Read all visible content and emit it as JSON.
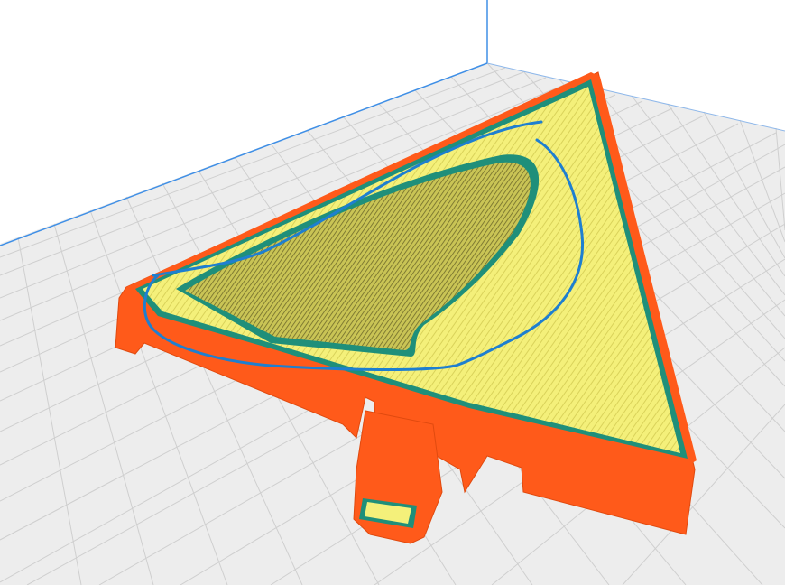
{
  "viewport": {
    "background": "#ffffff",
    "icons": {
      "build_plate": "grid-icon",
      "sliced_part": "triangular-sliced-part",
      "annotation": "freehand-blue-outline"
    }
  },
  "colors": {
    "grid_line": "#cfcfcf",
    "axis_blue": "#3f8fe6",
    "shell_orange": "#ff5a1a",
    "shell_orange_dark": "#e04a0f",
    "infill_yellow": "#f4f07a",
    "infill_dark": "#a3a040",
    "wall_teal": "#1f8f7a",
    "annotation_blue": "#1e7fd0"
  }
}
